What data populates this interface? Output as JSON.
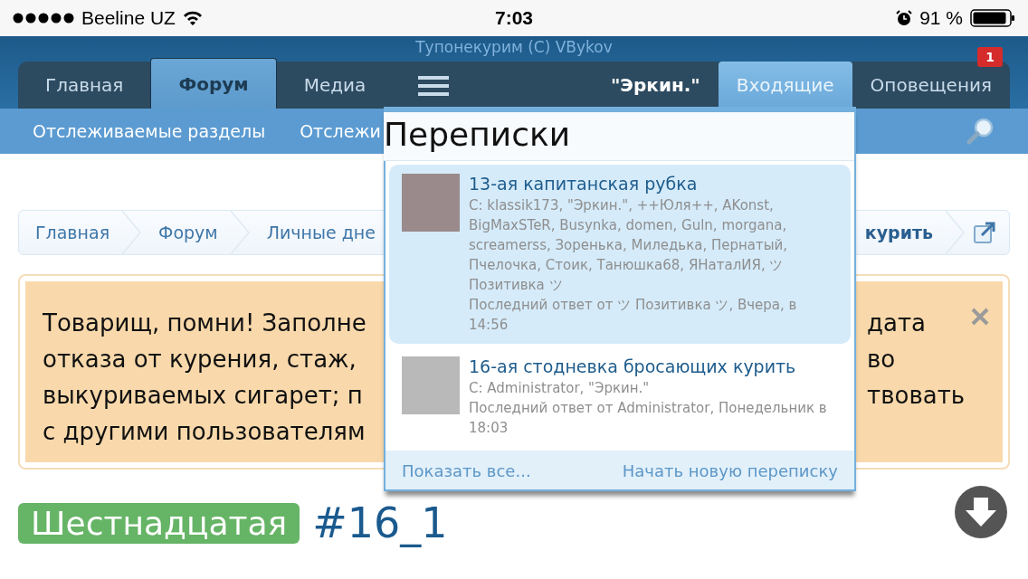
{
  "status_bar": {
    "carrier": "Beeline UZ",
    "time": "7:03",
    "battery": "91 %"
  },
  "site_title": "Тупонекурим (C) VBykov",
  "nav_tabs": [
    {
      "label": "Главная",
      "selected": false
    },
    {
      "label": "Форум",
      "selected": true
    },
    {
      "label": "Медиа",
      "selected": false
    }
  ],
  "user_nav": [
    {
      "label": "\"Эркин.\"",
      "kind": "user",
      "open": false
    },
    {
      "label": "Входящие",
      "kind": "link",
      "open": true
    },
    {
      "label": "Оповещения",
      "kind": "link",
      "open": false,
      "badge": "1"
    }
  ],
  "sub_nav": [
    "Отслеживаемые разделы",
    "Отслежи"
  ],
  "breadcrumbs": [
    "Главная",
    "Форум",
    "Личные дне",
    "курить"
  ],
  "notice": {
    "left_lines": [
      "Товарищ, помни! Заполне",
      "отказа от курения, стаж,",
      "выкуриваемых сигарет; п",
      "с другими пользователям"
    ],
    "right_lines": [
      "дата",
      "во",
      "твовать"
    ]
  },
  "thread": {
    "prefix": "Шестнадцатая",
    "title": "#16_1"
  },
  "inbox_popup": {
    "title": "Переписки",
    "conversations": [
      {
        "title": "13-ая капитанская рубка",
        "participants": "С: klassik173, \"Эркин.\", ++Юля++, AKonst, BigMaxSTeR, Busynka, domen, Guln, morgana, screamerss, Зоренька, Миледька, Пернатый, Пчелочка, Стоик, Танюшка68, ЯНаталИЯ, ツ Позитивка ツ",
        "last_reply": "Последний ответ от ツ Позитивка ツ, Вчера, в 14:56",
        "selected": true
      },
      {
        "title": "16-ая стодневка бросающих курить",
        "participants": "С: Administrator, \"Эркин.\"",
        "last_reply": "Последний ответ от Administrator, Понедельник в 18:03",
        "selected": false
      }
    ],
    "footer_links": [
      "Показать все...",
      "Начать новую переписку"
    ]
  }
}
